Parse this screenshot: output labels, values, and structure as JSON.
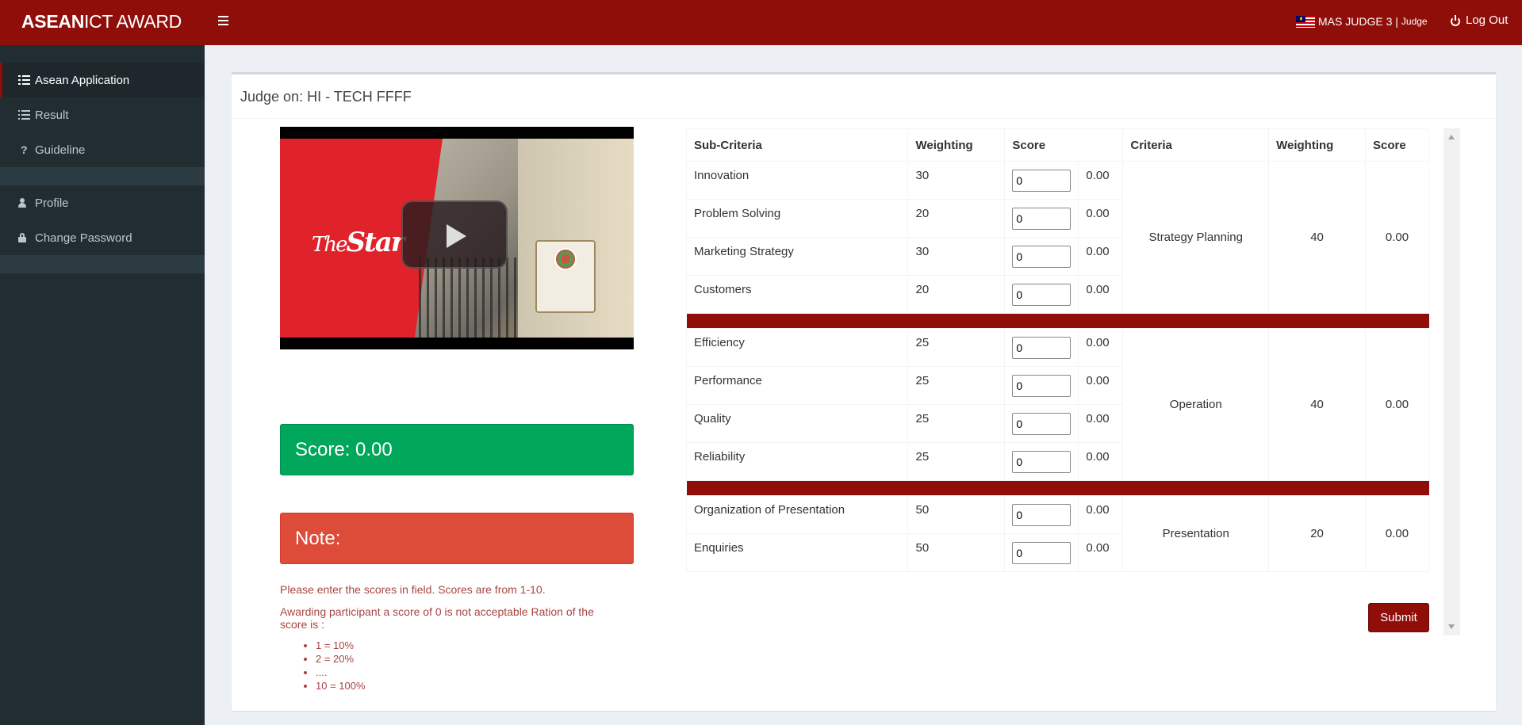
{
  "header": {
    "brand_bold": "ASEAN",
    "brand_rest": "ICT AWARD",
    "user_name": "MAS JUDGE 3 |",
    "user_role": "Judge",
    "logout_label": "Log Out",
    "bar_color": "#8f0e0a"
  },
  "sidebar": {
    "items": [
      {
        "label": "Asean Application",
        "icon": "list-icon",
        "active": true
      },
      {
        "label": "Result",
        "icon": "list-ol-icon"
      },
      {
        "label": "Guideline",
        "icon": "question-icon"
      },
      {
        "label": "Profile",
        "icon": "user-icon"
      },
      {
        "label": "Change Password",
        "icon": "lock-icon"
      }
    ]
  },
  "main": {
    "title": "Judge on: HI - TECH FFFF",
    "video": {
      "logo_the": "The",
      "logo_star": "Star"
    },
    "score_banner": "Score: 0.00",
    "note_banner": "Note:",
    "instruction_1": "Please enter the scores in field. Scores are from 1-10.",
    "instruction_2": "Awarding participant a score of 0 is not acceptable Ration of the score is :",
    "rations": [
      "1 = 10%",
      "2 = 20%",
      "....",
      "10 = 100%"
    ],
    "submit_label": "Submit"
  },
  "table": {
    "headers": [
      "Sub-Criteria",
      "Weighting",
      "Score",
      "Criteria",
      "Weighting",
      "Score"
    ],
    "groups": [
      {
        "criteria": "Strategy Planning",
        "weighting": "40",
        "score": "0.00",
        "rows": [
          {
            "name": "Innovation",
            "weighting": "30",
            "input": "0",
            "score": "0.00"
          },
          {
            "name": "Problem Solving",
            "weighting": "20",
            "input": "0",
            "score": "0.00"
          },
          {
            "name": "Marketing Strategy",
            "weighting": "30",
            "input": "0",
            "score": "0.00"
          },
          {
            "name": "Customers",
            "weighting": "20",
            "input": "0",
            "score": "0.00"
          }
        ]
      },
      {
        "criteria": "Operation",
        "weighting": "40",
        "score": "0.00",
        "rows": [
          {
            "name": "Efficiency",
            "weighting": "25",
            "input": "0",
            "score": "0.00"
          },
          {
            "name": "Performance",
            "weighting": "25",
            "input": "0",
            "score": "0.00"
          },
          {
            "name": "Quality",
            "weighting": "25",
            "input": "0",
            "score": "0.00"
          },
          {
            "name": "Reliability",
            "weighting": "25",
            "input": "0",
            "score": "0.00"
          }
        ]
      },
      {
        "criteria": "Presentation",
        "weighting": "20",
        "score": "0.00",
        "rows": [
          {
            "name": "Organization of Presentation",
            "weighting": "50",
            "input": "0",
            "score": "0.00"
          },
          {
            "name": "Enquiries",
            "weighting": "50",
            "input": "0",
            "score": "0.00"
          }
        ]
      }
    ]
  }
}
